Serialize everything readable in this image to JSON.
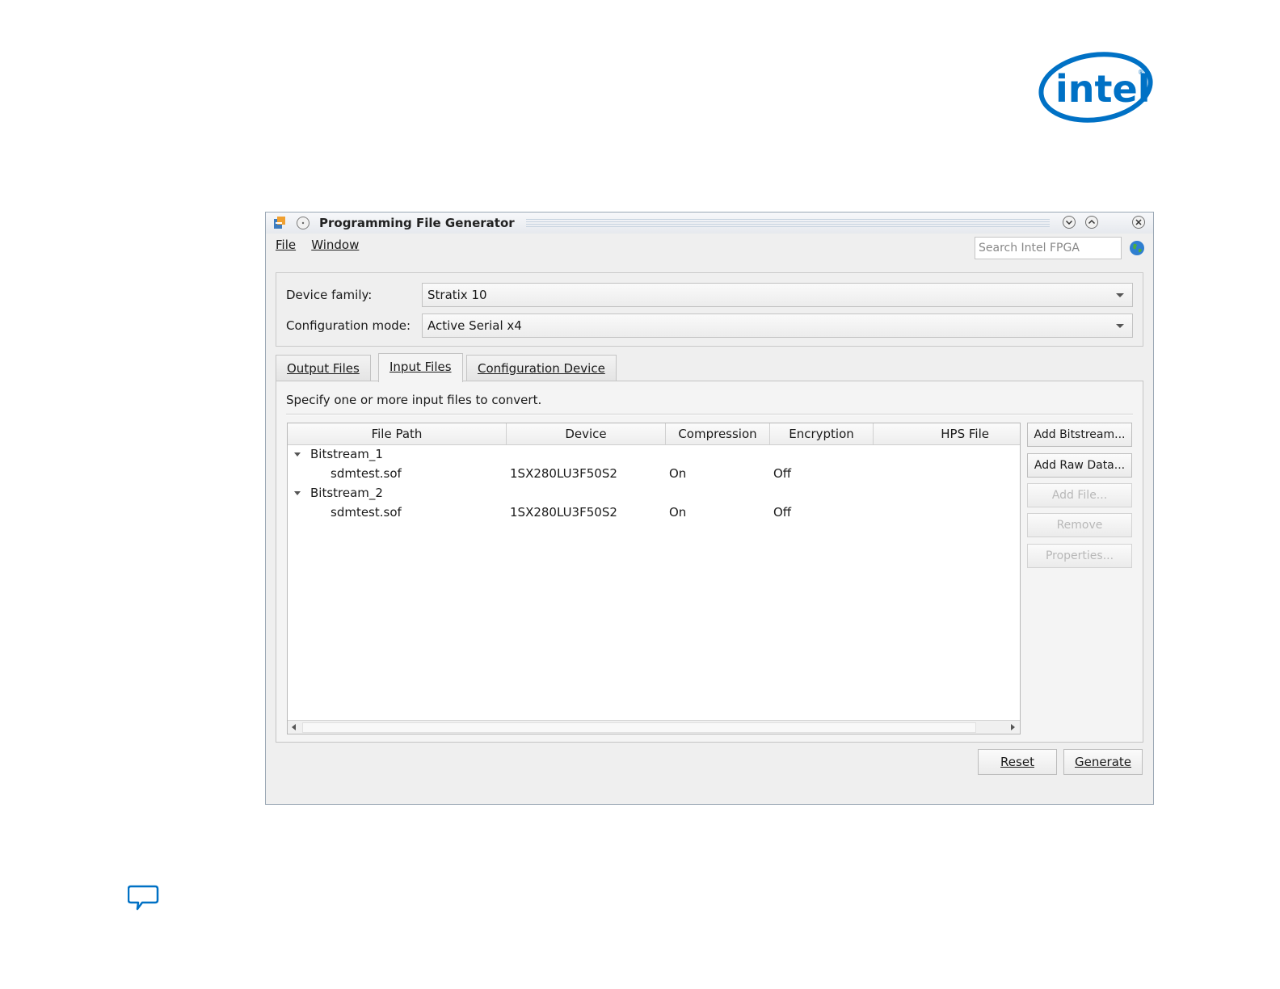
{
  "window": {
    "title": "Programming File Generator"
  },
  "menu": {
    "items": [
      {
        "label": "File"
      },
      {
        "label": "Window"
      }
    ]
  },
  "search": {
    "placeholder": "Search Intel FPGA"
  },
  "device": {
    "family_label": "Device family:",
    "family_value": "Stratix 10",
    "mode_label": "Configuration mode:",
    "mode_value": "Active Serial x4"
  },
  "tabs": [
    {
      "label": "Output Files",
      "active": false
    },
    {
      "label": "Input Files",
      "active": true
    },
    {
      "label": "Configuration Device",
      "active": false
    }
  ],
  "input_files": {
    "instruction": "Specify one or more input files to convert.",
    "columns": [
      "File Path",
      "Device",
      "Compression",
      "Encryption",
      "HPS File"
    ],
    "rows": [
      {
        "type": "group",
        "label": "Bitstream_1"
      },
      {
        "type": "file",
        "path": "sdmtest.sof",
        "device": "1SX280LU3F50S2",
        "compression": "On",
        "encryption": "Off",
        "hps": ""
      },
      {
        "type": "group",
        "label": "Bitstream_2"
      },
      {
        "type": "file",
        "path": "sdmtest.sof",
        "device": "1SX280LU3F50S2",
        "compression": "On",
        "encryption": "Off",
        "hps": ""
      }
    ]
  },
  "side_buttons": [
    {
      "label": "Add Bitstream...",
      "enabled": true
    },
    {
      "label": "Add Raw Data...",
      "enabled": true
    },
    {
      "label": "Add File...",
      "enabled": false
    },
    {
      "label": "Remove",
      "enabled": false
    },
    {
      "label": "Properties...",
      "enabled": false
    }
  ],
  "actions": {
    "reset": "Reset",
    "generate": "Generate"
  },
  "colors": {
    "intel_blue": "#0071c5",
    "window_bg": "#efefef"
  },
  "icons": [
    "intel-logo",
    "app-icon",
    "pin-icon",
    "minimize-icon",
    "maximize-icon",
    "close-icon",
    "globe-icon",
    "feedback-icon"
  ]
}
